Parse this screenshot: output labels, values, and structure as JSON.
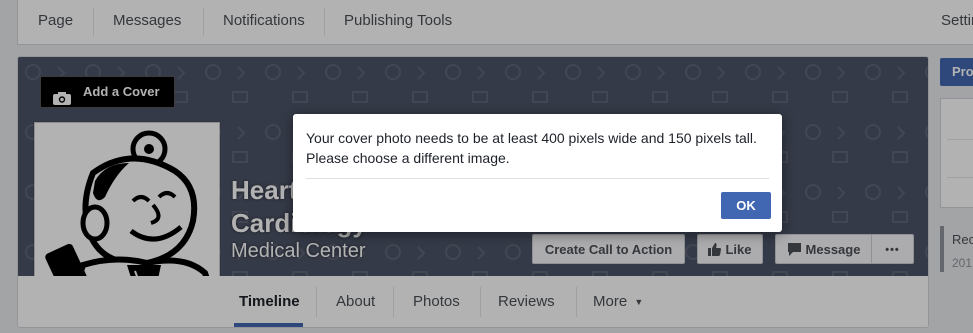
{
  "top_nav": {
    "items": [
      "Page",
      "Messages",
      "Notifications",
      "Publishing Tools"
    ],
    "settings": "Settin"
  },
  "cover": {
    "add_cover_label": "Add a Cover",
    "page_name_line1": "Heart",
    "page_name_line2": "Cardiology",
    "category": "Medical Center"
  },
  "actions": {
    "cta": "Create Call to Action",
    "like": "Like",
    "message": "Message",
    "more": "•••"
  },
  "tabs": [
    {
      "label": "Timeline"
    },
    {
      "label": "About"
    },
    {
      "label": "Photos"
    },
    {
      "label": "Reviews"
    },
    {
      "label": "More"
    }
  ],
  "right_column": {
    "button_label": "Pro",
    "sidebar_text1": "Rec",
    "sidebar_text2": "201"
  },
  "dialog": {
    "message": "Your cover photo needs to be at least 400 pixels wide and 150 pixels tall. Please choose a different image.",
    "ok_label": "OK"
  },
  "colors": {
    "brand": "#4267b2",
    "cover_bg": "#4d5467",
    "page_bg": "#e9ebee"
  }
}
